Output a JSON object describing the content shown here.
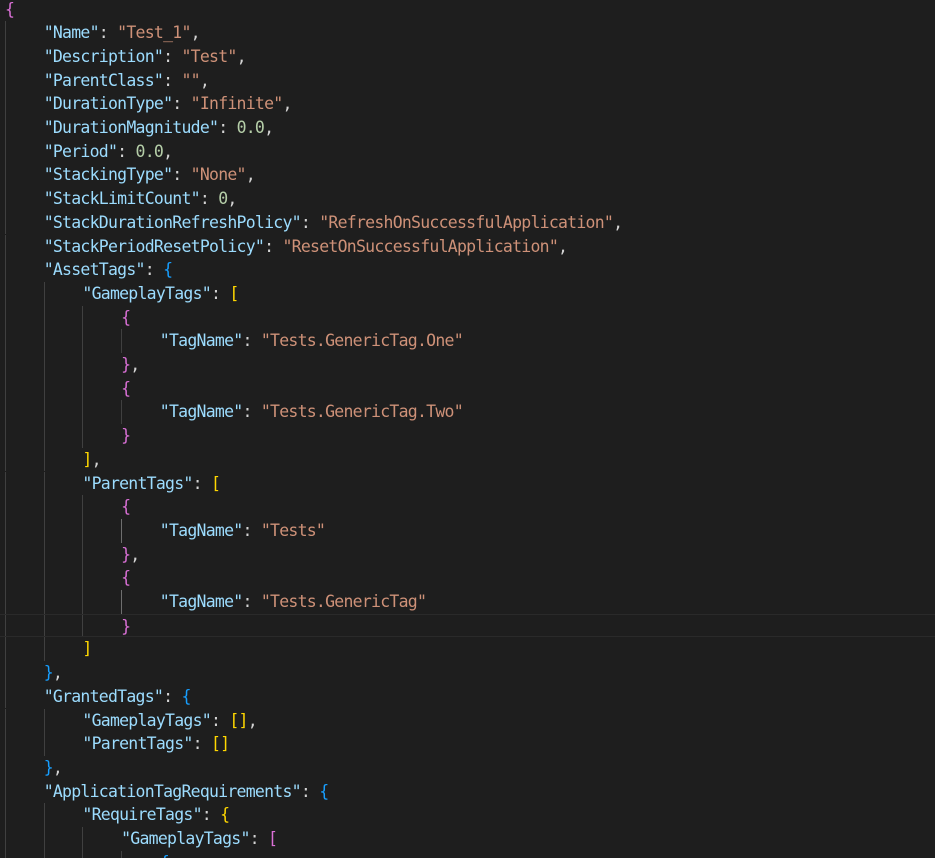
{
  "editor": {
    "language": "json",
    "colors": {
      "background": "#1e1e1e",
      "key": "#9cdcfe",
      "string": "#ce9178",
      "number": "#b5cea8",
      "punctuation": "#d4d4d4",
      "bracket_level1": "#da70d6",
      "bracket_level2": "#179fff",
      "bracket_level3": "#ffd700",
      "indent_guide": "#404040"
    },
    "lines": [
      [
        [
          "b1",
          "{"
        ]
      ],
      [
        [
          "k",
          "\"Name\""
        ],
        [
          "p",
          ": "
        ],
        [
          "s",
          "\"Test_1\""
        ],
        [
          "p",
          ","
        ]
      ],
      [
        [
          "k",
          "\"Description\""
        ],
        [
          "p",
          ": "
        ],
        [
          "s",
          "\"Test\""
        ],
        [
          "p",
          ","
        ]
      ],
      [
        [
          "k",
          "\"ParentClass\""
        ],
        [
          "p",
          ": "
        ],
        [
          "s",
          "\"\""
        ],
        [
          "p",
          ","
        ]
      ],
      [
        [
          "k",
          "\"DurationType\""
        ],
        [
          "p",
          ": "
        ],
        [
          "s",
          "\"Infinite\""
        ],
        [
          "p",
          ","
        ]
      ],
      [
        [
          "k",
          "\"DurationMagnitude\""
        ],
        [
          "p",
          ": "
        ],
        [
          "n",
          "0.0"
        ],
        [
          "p",
          ","
        ]
      ],
      [
        [
          "k",
          "\"Period\""
        ],
        [
          "p",
          ": "
        ],
        [
          "n",
          "0.0"
        ],
        [
          "p",
          ","
        ]
      ],
      [
        [
          "k",
          "\"StackingType\""
        ],
        [
          "p",
          ": "
        ],
        [
          "s",
          "\"None\""
        ],
        [
          "p",
          ","
        ]
      ],
      [
        [
          "k",
          "\"StackLimitCount\""
        ],
        [
          "p",
          ": "
        ],
        [
          "n",
          "0"
        ],
        [
          "p",
          ","
        ]
      ],
      [
        [
          "k",
          "\"StackDurationRefreshPolicy\""
        ],
        [
          "p",
          ": "
        ],
        [
          "s",
          "\"RefreshOnSuccessfulApplication\""
        ],
        [
          "p",
          ","
        ]
      ],
      [
        [
          "k",
          "\"StackPeriodResetPolicy\""
        ],
        [
          "p",
          ": "
        ],
        [
          "s",
          "\"ResetOnSuccessfulApplication\""
        ],
        [
          "p",
          ","
        ]
      ],
      [
        [
          "k",
          "\"AssetTags\""
        ],
        [
          "p",
          ": "
        ],
        [
          "b2",
          "{"
        ]
      ],
      [
        [
          "k",
          "\"GameplayTags\""
        ],
        [
          "p",
          ": "
        ],
        [
          "b3",
          "["
        ]
      ],
      [
        [
          "b1",
          "{"
        ]
      ],
      [
        [
          "k",
          "\"TagName\""
        ],
        [
          "p",
          ": "
        ],
        [
          "s",
          "\"Tests.GenericTag.One\""
        ]
      ],
      [
        [
          "b1",
          "}"
        ],
        [
          "p",
          ","
        ]
      ],
      [
        [
          "b1",
          "{"
        ]
      ],
      [
        [
          "k",
          "\"TagName\""
        ],
        [
          "p",
          ": "
        ],
        [
          "s",
          "\"Tests.GenericTag.Two\""
        ]
      ],
      [
        [
          "b1",
          "}"
        ]
      ],
      [
        [
          "b3",
          "]"
        ],
        [
          "p",
          ","
        ]
      ],
      [
        [
          "k",
          "\"ParentTags\""
        ],
        [
          "p",
          ": "
        ],
        [
          "b3",
          "["
        ]
      ],
      [
        [
          "b1",
          "{"
        ]
      ],
      [
        [
          "k",
          "\"TagName\""
        ],
        [
          "p",
          ": "
        ],
        [
          "s",
          "\"Tests\""
        ]
      ],
      [
        [
          "b1",
          "}"
        ],
        [
          "p",
          ","
        ]
      ],
      [
        [
          "b1",
          "{"
        ]
      ],
      [
        [
          "k",
          "\"TagName\""
        ],
        [
          "p",
          ": "
        ],
        [
          "s",
          "\"Tests.GenericTag\""
        ]
      ],
      [
        [
          "b1",
          "}"
        ]
      ],
      [
        [
          "b3",
          "]"
        ]
      ],
      [
        [
          "b2",
          "}"
        ],
        [
          "p",
          ","
        ]
      ],
      [
        [
          "k",
          "\"GrantedTags\""
        ],
        [
          "p",
          ": "
        ],
        [
          "b2",
          "{"
        ]
      ],
      [
        [
          "k",
          "\"GameplayTags\""
        ],
        [
          "p",
          ": "
        ],
        [
          "b3",
          "[]"
        ],
        [
          "p",
          ","
        ]
      ],
      [
        [
          "k",
          "\"ParentTags\""
        ],
        [
          "p",
          ": "
        ],
        [
          "b3",
          "[]"
        ]
      ],
      [
        [
          "b2",
          "}"
        ],
        [
          "p",
          ","
        ]
      ],
      [
        [
          "k",
          "\"ApplicationTagRequirements\""
        ],
        [
          "p",
          ": "
        ],
        [
          "b2",
          "{"
        ]
      ],
      [
        [
          "k",
          "\"RequireTags\""
        ],
        [
          "p",
          ": "
        ],
        [
          "b3",
          "{"
        ]
      ],
      [
        [
          "k",
          "\"GameplayTags\""
        ],
        [
          "p",
          ": "
        ],
        [
          "b1",
          "["
        ]
      ],
      [
        [
          "b2",
          "{"
        ]
      ]
    ]
  }
}
